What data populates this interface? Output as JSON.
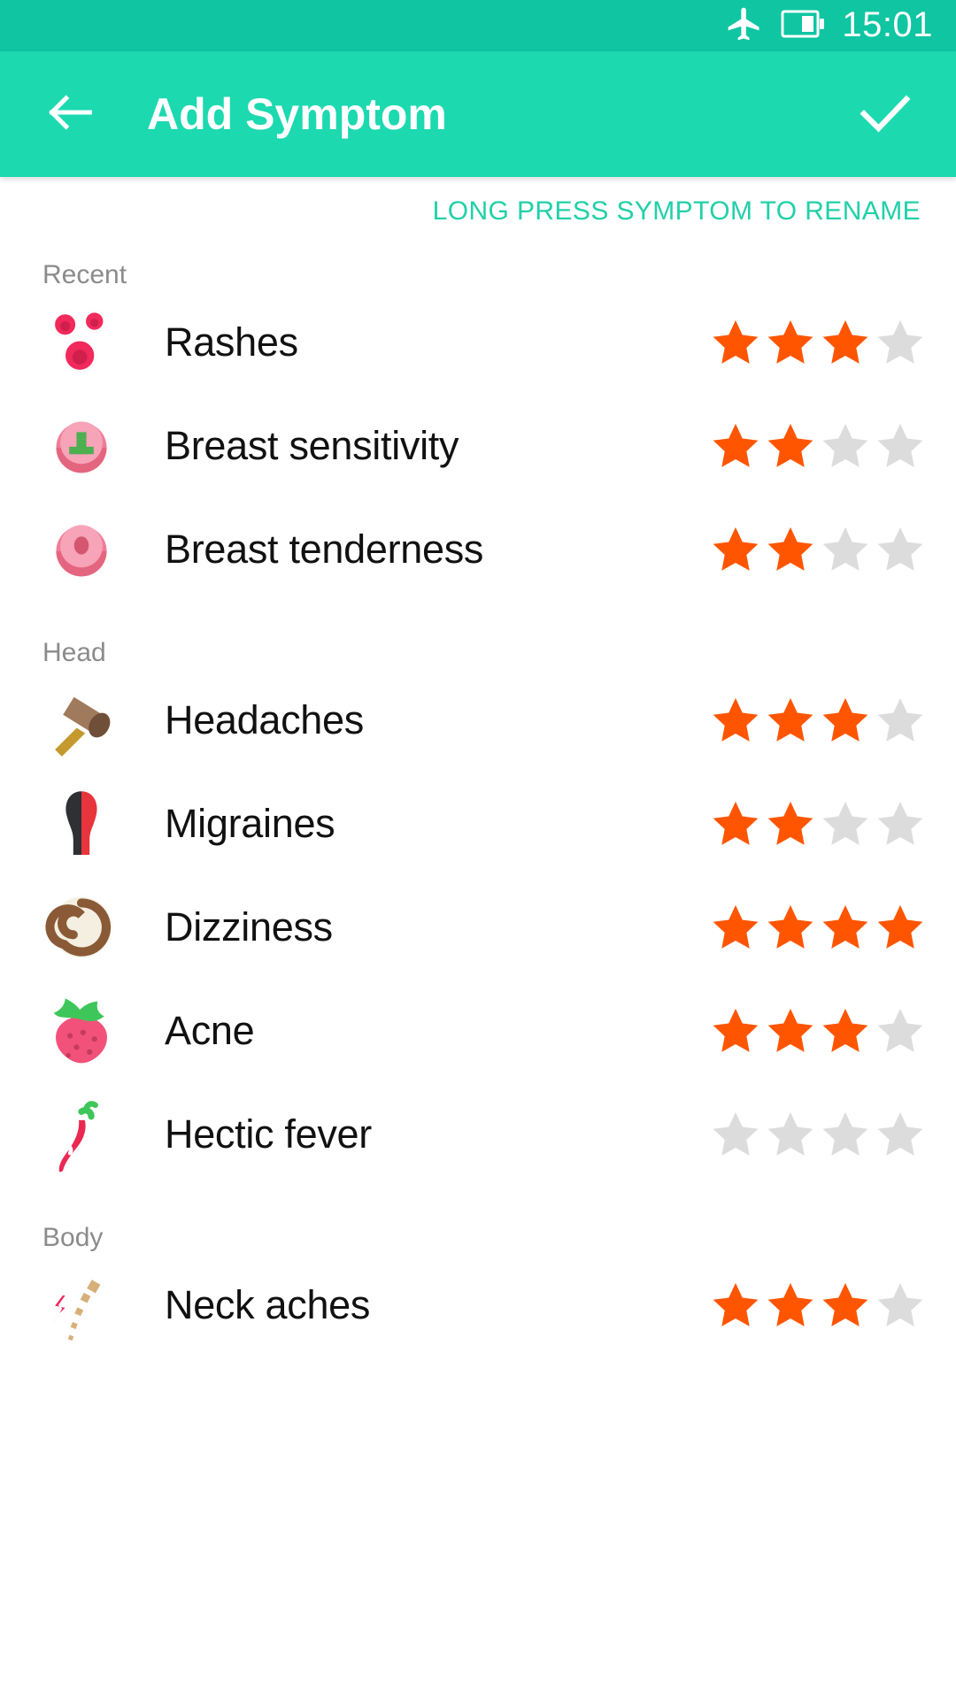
{
  "status_bar": {
    "airplane_icon": "airplane-mode-icon",
    "battery_icon": "battery-icon",
    "time": "15:01"
  },
  "app_bar": {
    "back_icon": "back-arrow-icon",
    "title": "Add Symptom",
    "confirm_icon": "check-icon"
  },
  "hint": "LONG PRESS SYMPTOM TO RENAME",
  "colors": {
    "status_bar_bg": "#0fc5a2",
    "app_bar_bg": "#1cd9b0",
    "accent": "#21d0a8",
    "star_active": "#ff5500",
    "star_inactive": "#dcdcdc",
    "section_label": "#8b8b8b",
    "row_label": "#111111"
  },
  "max_rating": 4,
  "sections": [
    {
      "title": "Recent",
      "items": [
        {
          "label": "Rashes",
          "icon": "rash-spots-icon",
          "rating": 3
        },
        {
          "label": "Breast sensitivity",
          "icon": "breast-plus-icon",
          "rating": 2
        },
        {
          "label": "Breast tenderness",
          "icon": "breast-icon",
          "rating": 2
        }
      ]
    },
    {
      "title": "Head",
      "items": [
        {
          "label": "Headaches",
          "icon": "mallet-icon",
          "rating": 3
        },
        {
          "label": "Migraines",
          "icon": "split-head-icon",
          "rating": 2
        },
        {
          "label": "Dizziness",
          "icon": "spiral-icon",
          "rating": 4
        },
        {
          "label": "Acne",
          "icon": "strawberry-icon",
          "rating": 3
        },
        {
          "label": "Hectic fever",
          "icon": "chili-pepper-icon",
          "rating": 0
        }
      ]
    },
    {
      "title": "Body",
      "items": [
        {
          "label": "Neck aches",
          "icon": "spine-bolt-icon",
          "rating": 3
        }
      ]
    }
  ]
}
